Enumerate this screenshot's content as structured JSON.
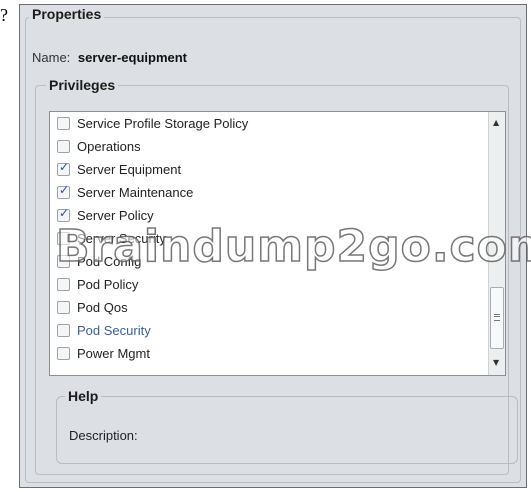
{
  "stray_mark": "?",
  "properties": {
    "title": "Properties",
    "name_label": "Name:",
    "name_value": "server-equipment"
  },
  "privileges": {
    "title": "Privileges",
    "items": [
      {
        "label": "Service Profile Storage Policy",
        "checked": false
      },
      {
        "label": "Operations",
        "checked": false
      },
      {
        "label": "Server Equipment",
        "checked": true
      },
      {
        "label": "Server Maintenance",
        "checked": true
      },
      {
        "label": "Server Policy",
        "checked": true
      },
      {
        "label": "Server Security",
        "checked": false
      },
      {
        "label": "Pod Config",
        "checked": false
      },
      {
        "label": "Pod Policy",
        "checked": false
      },
      {
        "label": "Pod Qos",
        "checked": false
      },
      {
        "label": "Pod Security",
        "checked": false
      },
      {
        "label": "Power Mgmt",
        "checked": false
      }
    ]
  },
  "help": {
    "title": "Help",
    "description_label": "Description:"
  },
  "watermark": "Braindump2go.com",
  "colors": {
    "panel_bg": "#dcdfe3",
    "check_color": "#1f4fb0",
    "link_text": "#3b5f98"
  },
  "icons": {
    "checkbox": "checkbox-icon",
    "scroll_up": "up-arrow-icon",
    "scroll_down": "down-arrow-icon",
    "scroll_grip": "grip-icon"
  }
}
